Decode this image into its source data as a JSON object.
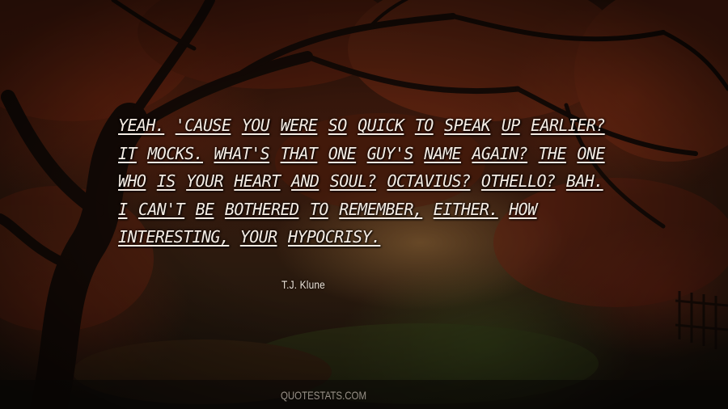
{
  "quote": {
    "text": "Yeah. 'Cause you were so quick to speak up earlier? it mocks. What's that one guy's name again? The one who is your heart and soul? Octavius? Othello? Bah. I can't be bothered to remember, either. How interesting, your hypocrisy."
  },
  "author": {
    "name": "T.J. Klune"
  },
  "watermark": {
    "text": "QUOTESTATS.COM"
  },
  "colors": {
    "text": "#f4ece4",
    "foliage": "#7a2a12",
    "trunk": "#140a06"
  }
}
